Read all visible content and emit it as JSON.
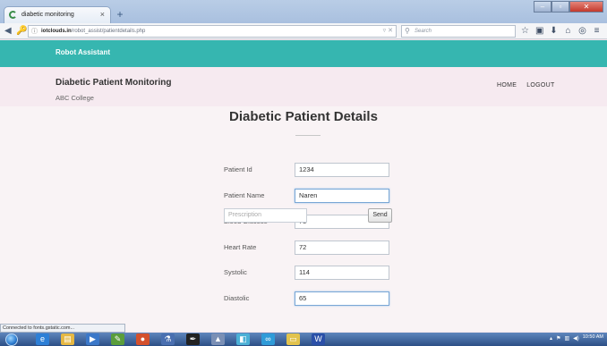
{
  "browser": {
    "tab_title": "diabetic monitoring",
    "tab_close": "×",
    "new_tab": "+",
    "url_host": "iotclouds.in",
    "url_path": "/robot_assist/patientdetails.php",
    "search_placeholder": "Search",
    "status_text": "Connected to fonts.gstatic.com..."
  },
  "site": {
    "brand": "Robot Assistant",
    "title": "Diabetic Patient Monitoring",
    "subtitle": "ABC College",
    "nav": [
      "HOME",
      "LOGOUT"
    ]
  },
  "form": {
    "heading": "Diabetic Patient Details",
    "fields": [
      {
        "label": "Patient Id",
        "value": "1234"
      },
      {
        "label": "Patient Name",
        "value": "Naren"
      },
      {
        "label": "Blood Glucose",
        "value": "75"
      },
      {
        "label": "Heart Rate",
        "value": "72"
      },
      {
        "label": "Systolic",
        "value": "114"
      },
      {
        "label": "Diastolic",
        "value": "65"
      }
    ],
    "prescription_placeholder": "Prescription",
    "send_label": "Send"
  },
  "taskbar": {
    "clock_time": "10:50 AM"
  },
  "colors": {
    "accent": "#36b6b0",
    "header_bg": "#f6eaf0",
    "content_bg": "#f9f3f5"
  }
}
